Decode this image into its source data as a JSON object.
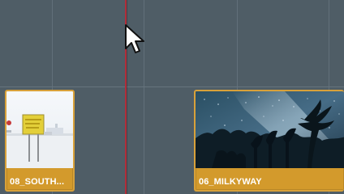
{
  "timeline": {
    "clips": [
      {
        "label": "08_SOUTH...",
        "thumbnail": "south-pole-sign-thumbnail"
      },
      {
        "label": "06_MILKYWAY",
        "thumbnail": "milky-way-night-sky-thumbnail"
      }
    ],
    "colors": {
      "background": "#4f5d66",
      "clip_accent": "#d39a2c",
      "playhead": "#b12d3a"
    }
  }
}
